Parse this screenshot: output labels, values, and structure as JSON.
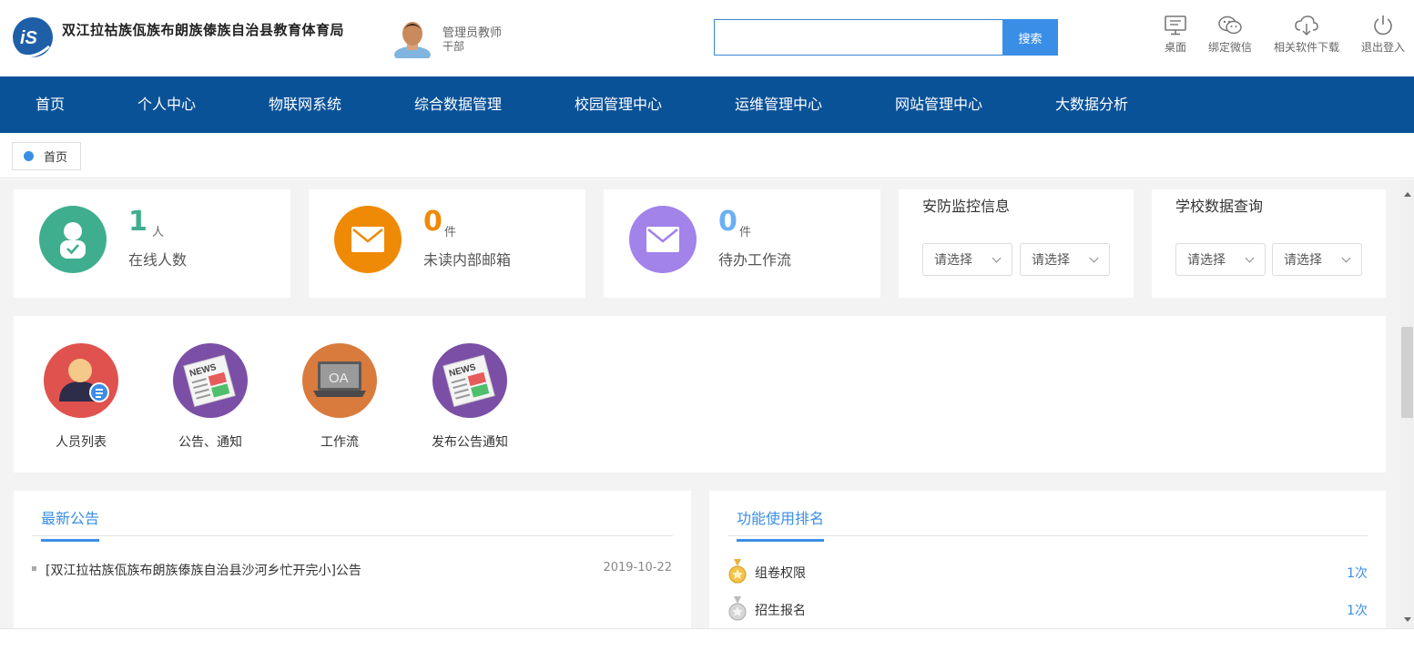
{
  "header": {
    "org_title": "双江拉祜族佤族布朗族傣族自治县教育体育局",
    "user_name": "管理员教师",
    "user_role": "干部",
    "search_value": "",
    "search_button": "搜索",
    "tools": [
      {
        "label": "桌面",
        "icon": "desktop-icon"
      },
      {
        "label": "绑定微信",
        "icon": "wechat-icon"
      },
      {
        "label": "相关软件下载",
        "icon": "cloud-download-icon"
      },
      {
        "label": "退出登入",
        "icon": "power-icon"
      }
    ]
  },
  "nav": {
    "items": [
      "首页",
      "个人中心",
      "物联网系统",
      "综合数据管理",
      "校园管理中心",
      "运维管理中心",
      "网站管理中心",
      "大数据分析"
    ]
  },
  "tabs": {
    "home": "首页"
  },
  "stats": [
    {
      "value": "1",
      "unit": "人",
      "label": "在线人数",
      "color": "#3fae8f",
      "icon": "user-check-icon"
    },
    {
      "value": "0",
      "unit": "件",
      "label": "未读内部邮箱",
      "color": "#ef8a06",
      "icon": "mail-icon"
    },
    {
      "value": "0",
      "unit": "件",
      "label": "待办工作流",
      "color": "#a183ea",
      "icon": "mail-icon"
    }
  ],
  "security_panel": {
    "title": "安防监控信息",
    "select1": "请选择",
    "select2": "请选择"
  },
  "school_panel": {
    "title": "学校数据查询",
    "select1": "请选择",
    "select2": "请选择"
  },
  "quick_links": [
    {
      "label": "人员列表",
      "icon": "person-list-icon",
      "color": "#e0524e"
    },
    {
      "label": "公告、通知",
      "icon": "newspaper-icon",
      "color": "#7b4fa6"
    },
    {
      "label": "工作流",
      "icon": "oa-laptop-icon",
      "color": "#d97b3d"
    },
    {
      "label": "发布公告通知",
      "icon": "newspaper-icon",
      "color": "#7b4fa6"
    }
  ],
  "notices": {
    "title": "最新公告",
    "items": [
      {
        "text": "[双江拉祜族佤族布朗族傣族自治县沙河乡忙开完小]公告",
        "date": "2019-10-22"
      }
    ]
  },
  "ranking": {
    "title": "功能使用排名",
    "items": [
      {
        "name": "组卷权限",
        "count": "1次",
        "medal": "gold-medal-icon"
      },
      {
        "name": "招生报名",
        "count": "1次",
        "medal": "silver-medal-icon"
      }
    ]
  },
  "oa_text": "OA",
  "news_text": "NEWS"
}
